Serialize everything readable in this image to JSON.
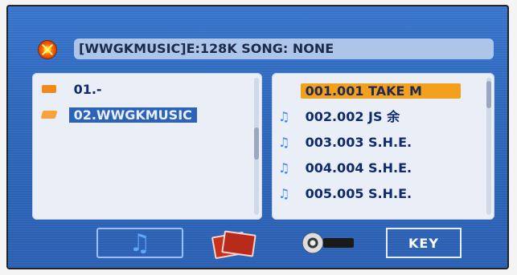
{
  "status_bar": {
    "text": "[WWGKMUSIC]E:128K SONG: NONE"
  },
  "folder_list": {
    "items": [
      {
        "label": "01.-"
      },
      {
        "label": "02.WWGKMUSIC",
        "selected": true
      }
    ]
  },
  "song_list": {
    "items": [
      {
        "label": "001.001 TAKE M",
        "highlighted": true
      },
      {
        "label": "002.002 JS 余"
      },
      {
        "label": "003.003 S.H.E."
      },
      {
        "label": "004.004 S.H.E."
      },
      {
        "label": "005.005 S.H.E."
      }
    ]
  },
  "bottom_tabs": {
    "music": {
      "icon": "music-note-icon",
      "active": true
    },
    "photo": {
      "icon": "photo-icon"
    },
    "video": {
      "icon": "film-reel-icon"
    },
    "key": {
      "label": "KEY"
    }
  },
  "colors": {
    "background": "#2f69bf",
    "panel": "#e9eef7",
    "status_bar": "#aec5ea",
    "selected_folder": "#2d63b7",
    "highlight_song": "#f3a11d",
    "folder_icon": "#f08a1c",
    "note_icon": "#3a86e8",
    "text": "#0d2a6e"
  }
}
